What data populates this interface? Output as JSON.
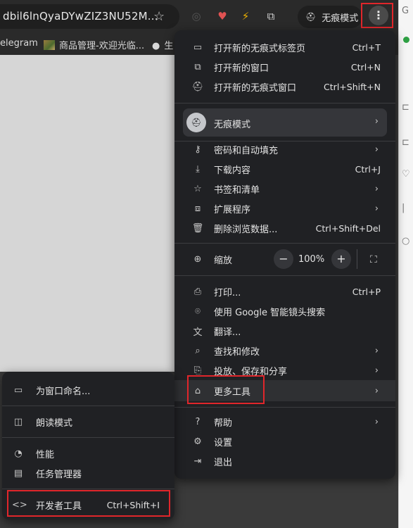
{
  "browser": {
    "url_text": "dbil6lnQyaDYwZIZ3NU52M...",
    "incognito_label": "无痕模式"
  },
  "bookmarks": [
    {
      "label": "elegram"
    },
    {
      "label": "商品管理-欢迎光临..."
    },
    {
      "label": "生"
    }
  ],
  "menu": {
    "group1": [
      {
        "label": "打开新的无痕式标签页",
        "shortcut": "Ctrl+T",
        "icon": "new-tab-icon"
      },
      {
        "label": "打开新的窗口",
        "shortcut": "Ctrl+N",
        "icon": "new-window-icon"
      },
      {
        "label": "打开新的无痕式窗口",
        "shortcut": "Ctrl+Shift+N",
        "icon": "incognito-icon"
      }
    ],
    "profile": {
      "label": "无痕模式",
      "icon": "incognito-icon"
    },
    "group2": [
      {
        "label": "密码和自动填充",
        "shortcut": "",
        "icon": "key-icon",
        "submenu": true
      },
      {
        "label": "下载内容",
        "shortcut": "Ctrl+J",
        "icon": "download-icon"
      },
      {
        "label": "书签和清单",
        "shortcut": "",
        "icon": "star-icon",
        "submenu": true
      },
      {
        "label": "扩展程序",
        "shortcut": "",
        "icon": "puzzle-icon",
        "submenu": true
      },
      {
        "label": "删除浏览数据...",
        "shortcut": "Ctrl+Shift+Del",
        "icon": "trash-icon"
      }
    ],
    "zoom": {
      "label": "缩放",
      "minus": "−",
      "value": "100%",
      "plus": "+"
    },
    "group3": [
      {
        "label": "打印...",
        "shortcut": "Ctrl+P",
        "icon": "print-icon"
      },
      {
        "label": "使用 Google 智能镜头搜索",
        "shortcut": "",
        "icon": "lens-icon"
      },
      {
        "label": "翻译...",
        "shortcut": "",
        "icon": "translate-icon"
      },
      {
        "label": "查找和修改",
        "shortcut": "",
        "icon": "find-icon",
        "submenu": true
      },
      {
        "label": "投放、保存和分享",
        "shortcut": "",
        "icon": "cast-icon",
        "submenu": true
      },
      {
        "label": "更多工具",
        "shortcut": "",
        "icon": "toolbox-icon",
        "submenu": true
      }
    ],
    "group4": [
      {
        "label": "帮助",
        "shortcut": "",
        "icon": "help-icon",
        "submenu": true
      },
      {
        "label": "设置",
        "shortcut": "",
        "icon": "gear-icon"
      },
      {
        "label": "退出",
        "shortcut": "",
        "icon": "exit-icon"
      }
    ]
  },
  "submenu": {
    "items": [
      {
        "label": "为窗口命名...",
        "shortcut": "",
        "icon": "window-icon"
      },
      {
        "label": "朗读模式",
        "shortcut": "",
        "icon": "reading-mode-icon"
      },
      {
        "label": "性能",
        "shortcut": "",
        "icon": "performance-icon"
      },
      {
        "label": "任务管理器",
        "shortcut": "",
        "icon": "task-manager-icon"
      },
      {
        "label": "开发者工具",
        "shortcut": "Ctrl+Shift+I",
        "icon": "code-icon"
      }
    ]
  },
  "colors": {
    "highlight_box": "#e0262b",
    "menu_bg": "#202124"
  }
}
